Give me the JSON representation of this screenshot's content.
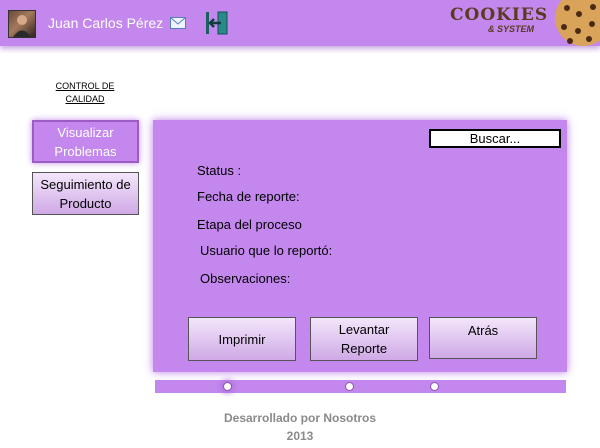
{
  "header": {
    "user_name": "Juan Carlos Pérez",
    "logo_main": "COOKIES",
    "logo_sub": "& SYSTEM"
  },
  "sidebar": {
    "section_title_line1": "CONTROL DE",
    "section_title_line2": "CALIDAD",
    "items": [
      {
        "line1": "Visualizar",
        "line2": "Problemas",
        "active": true
      },
      {
        "line1": "Seguimiento de",
        "line2": "Producto",
        "active": false
      }
    ]
  },
  "panel": {
    "search_label": "Buscar...",
    "fields": {
      "status": "Status :",
      "report_date": "Fecha de reporte:",
      "process_stage": "Etapa del proceso",
      "reporting_user": "Usuario que lo reportó:",
      "observations": "Observaciones:"
    },
    "buttons": {
      "print": "Imprimir",
      "raise_line1": "Levantar",
      "raise_line2": "Reporte",
      "back": "Atrás"
    }
  },
  "progress": {
    "steps": 3,
    "current_step": 1
  },
  "footer": {
    "line1": "Desarrollado por Nosotros",
    "line2": "2013"
  },
  "colors": {
    "accent": "#c387ee",
    "footer_text": "#8a8a8a"
  },
  "icons": [
    "user-avatar",
    "mail-icon",
    "exit-door-icon",
    "cookie-icon"
  ]
}
